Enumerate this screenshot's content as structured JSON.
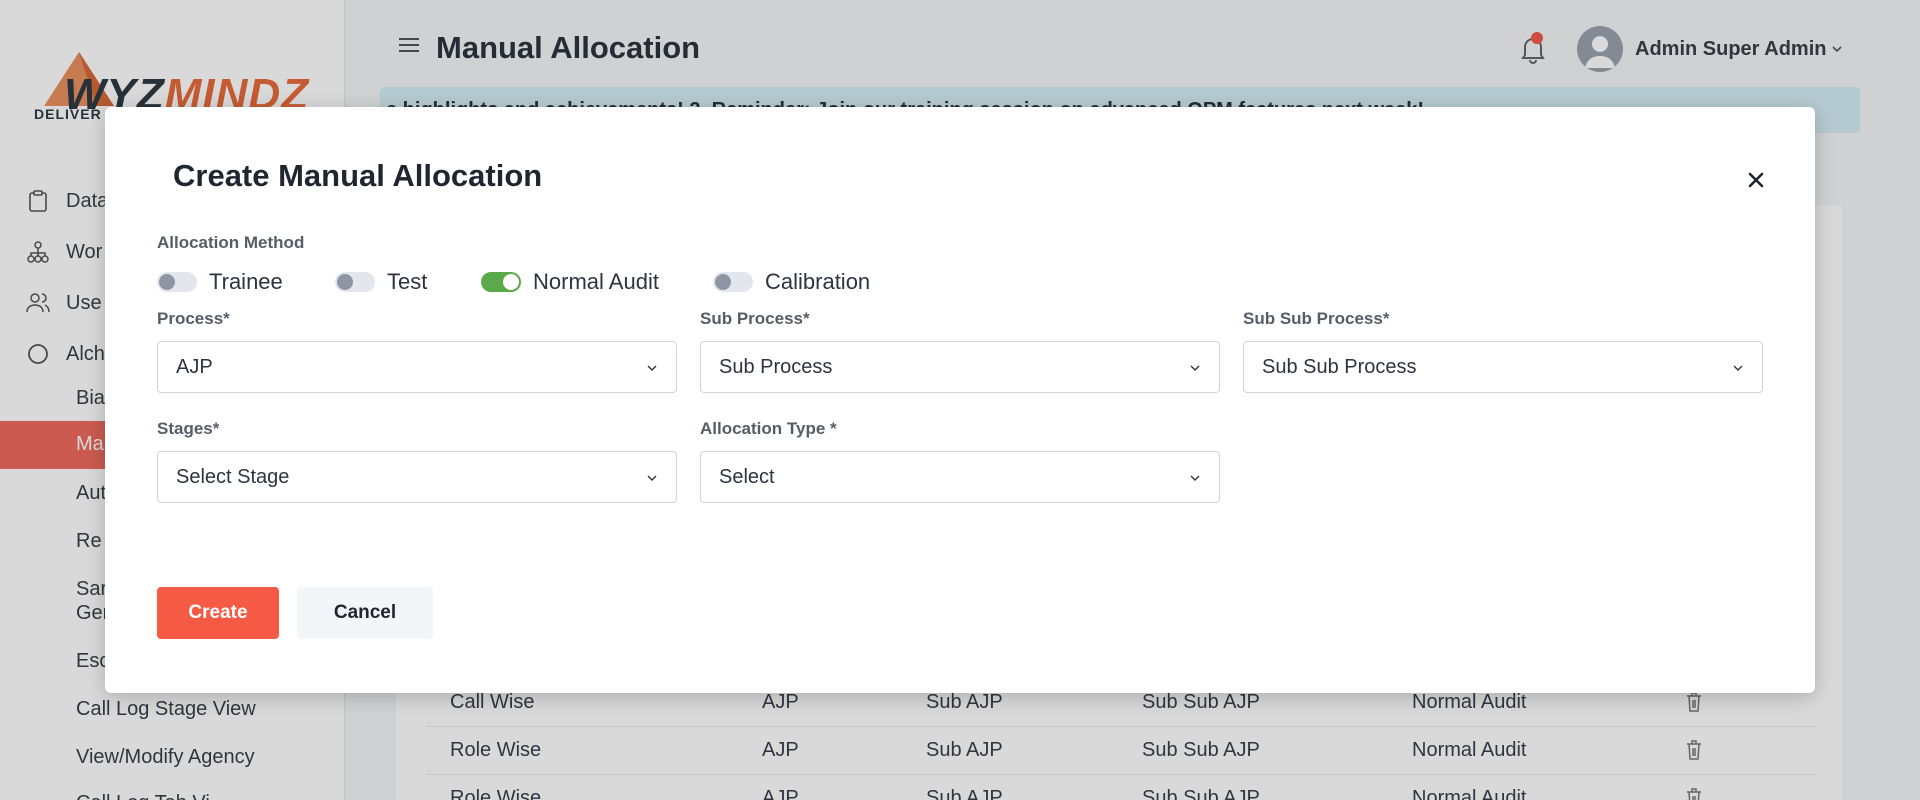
{
  "sidebar": {
    "logo_text_a": "WYZ",
    "logo_text_b": "MINDZ",
    "logo_sub": "DELIVER",
    "items": [
      {
        "label": "Data",
        "icon": "clipboard-icon"
      },
      {
        "label": "Wor",
        "icon": "hierarchy-icon"
      },
      {
        "label": "Use",
        "icon": "users-icon"
      },
      {
        "label": "Alch",
        "icon": "circle-icon"
      }
    ],
    "sub_items": [
      "Bia",
      "Ma",
      "Aut",
      "Re",
      "Sar",
      "Ger",
      "Esc",
      "Call Log Stage View",
      "View/Modify Agency",
      "Call Log Tab Vi"
    ]
  },
  "header": {
    "title": "Manual Allocation",
    "user_name": "Admin Super Admin",
    "banner_text": "e highlights and achievements! 2. Reminder: Join our training session on advanced QPM features next week!"
  },
  "table": {
    "rows": [
      {
        "type": "Call Wise",
        "process": "AJP",
        "sub_process": "Sub AJP",
        "sub_sub_process": "Sub Sub AJP",
        "method": "Normal Audit"
      },
      {
        "type": "Role Wise",
        "process": "AJP",
        "sub_process": "Sub AJP",
        "sub_sub_process": "Sub Sub AJP",
        "method": "Normal Audit"
      },
      {
        "type": "Role Wise",
        "process": "AJP",
        "sub_process": "Sub AJP",
        "sub_sub_process": "Sub Sub AJP",
        "method": "Normal Audit"
      }
    ]
  },
  "modal": {
    "title": "Create Manual Allocation",
    "allocation_method_label": "Allocation Method",
    "toggles": [
      {
        "label": "Trainee",
        "on": false
      },
      {
        "label": "Test",
        "on": false
      },
      {
        "label": "Normal Audit",
        "on": true
      },
      {
        "label": "Calibration",
        "on": false
      }
    ],
    "fields": {
      "process": {
        "label": "Process*",
        "value": "AJP"
      },
      "sub_process": {
        "label": "Sub Process*",
        "value": "Sub Process"
      },
      "sub_sub_process": {
        "label": "Sub Sub Process*",
        "value": "Sub Sub Process"
      },
      "stages": {
        "label": "Stages*",
        "value": "Select Stage"
      },
      "allocation_type": {
        "label": "Allocation Type *",
        "value": "Select"
      }
    },
    "create_label": "Create",
    "cancel_label": "Cancel"
  },
  "colors": {
    "accent": "#f55a44",
    "active_nav": "#ef6b5e",
    "toggle_on": "#5aaa4a",
    "banner": "#d5eef5"
  }
}
